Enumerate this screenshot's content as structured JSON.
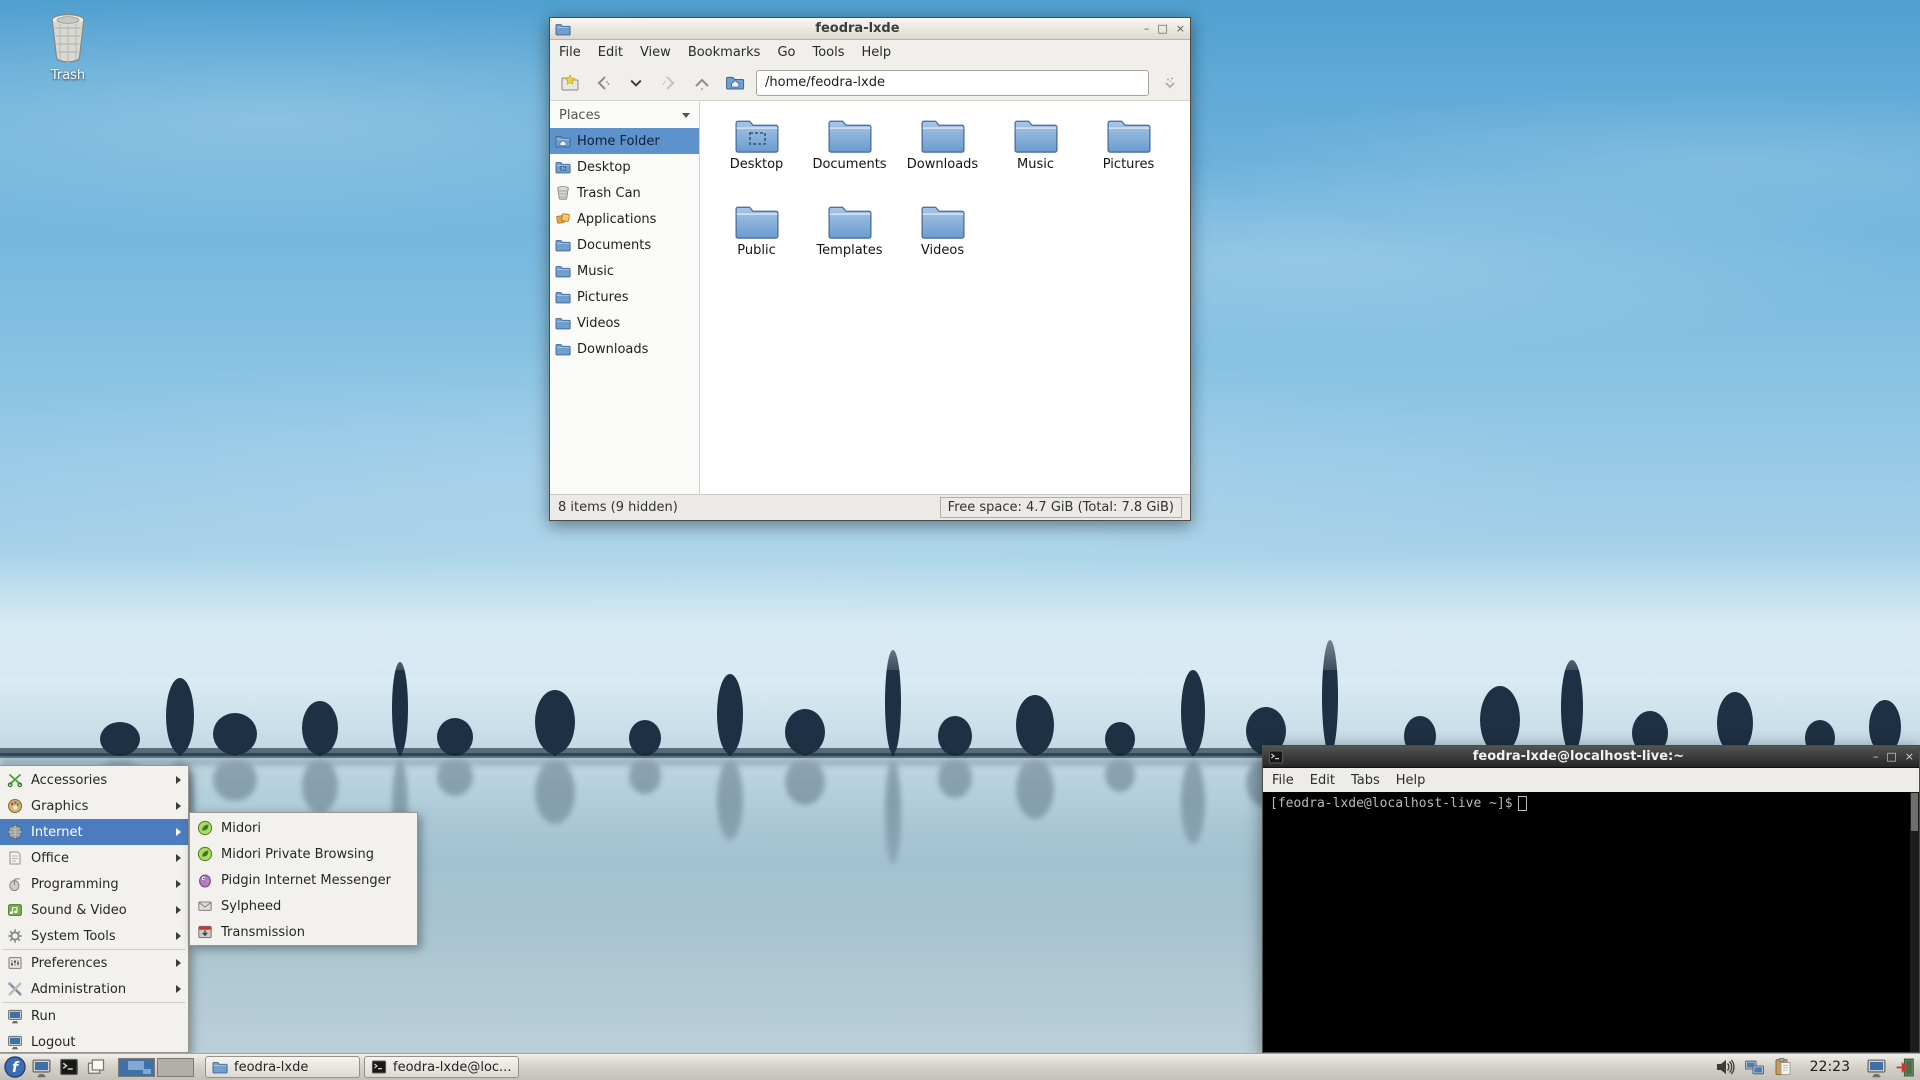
{
  "desktop": {
    "trash_label": "Trash",
    "trash_icon": "trash-basket-icon",
    "wallpaper": "blue foggy treeline with water reflection"
  },
  "file_manager": {
    "title": "feodra-lxde",
    "window_icon": "folder-icon",
    "buttons": {
      "minimize": "–",
      "maximize": "□",
      "close": "×"
    },
    "menu": {
      "file": "File",
      "edit": "Edit",
      "view": "View",
      "bookmarks": "Bookmarks",
      "go": "Go",
      "tools": "Tools",
      "help": "Help"
    },
    "toolbar_icons": [
      "new-tab-folder-icon",
      "back-icon",
      "history-dropdown-icon",
      "forward-icon",
      "up-icon",
      "home-icon",
      "jump-to-icon"
    ],
    "address": "/home/feodra-lxde",
    "places": {
      "header": "Places",
      "items": [
        {
          "label": "Home Folder",
          "icon": "home-folder-icon",
          "selected": true
        },
        {
          "label": "Desktop",
          "icon": "desktop-folder-icon",
          "selected": false
        },
        {
          "label": "Trash Can",
          "icon": "trash-icon",
          "selected": false
        },
        {
          "label": "Applications",
          "icon": "applications-icon",
          "selected": false
        },
        {
          "label": "Documents",
          "icon": "folder-icon",
          "selected": false
        },
        {
          "label": "Music",
          "icon": "folder-icon",
          "selected": false
        },
        {
          "label": "Pictures",
          "icon": "folder-icon",
          "selected": false
        },
        {
          "label": "Videos",
          "icon": "folder-icon",
          "selected": false
        },
        {
          "label": "Downloads",
          "icon": "folder-icon",
          "selected": false
        }
      ]
    },
    "folders": [
      {
        "name": "Desktop",
        "icon": "folder-desktop-icon"
      },
      {
        "name": "Documents",
        "icon": "folder-icon"
      },
      {
        "name": "Downloads",
        "icon": "folder-icon"
      },
      {
        "name": "Music",
        "icon": "folder-icon"
      },
      {
        "name": "Pictures",
        "icon": "folder-icon"
      },
      {
        "name": "Public",
        "icon": "folder-icon"
      },
      {
        "name": "Templates",
        "icon": "folder-icon"
      },
      {
        "name": "Videos",
        "icon": "folder-icon"
      }
    ],
    "status_left": "8 items (9 hidden)",
    "status_right": "Free space: 4.7 GiB (Total: 7.8 GiB)"
  },
  "terminal": {
    "title": "feodra-lxde@localhost-live:~",
    "window_icon": "terminal-icon",
    "buttons": {
      "minimize": "–",
      "maximize": "□",
      "close": "×"
    },
    "menu": {
      "file": "File",
      "edit": "Edit",
      "tabs": "Tabs",
      "help": "Help"
    },
    "prompt": "[feodra-lxde@localhost-live ~]$"
  },
  "app_menu": {
    "items": [
      {
        "label": "Accessories",
        "icon": "accessories-icon",
        "has_submenu": true
      },
      {
        "label": "Graphics",
        "icon": "graphics-icon",
        "has_submenu": true
      },
      {
        "label": "Internet",
        "icon": "internet-globe-icon",
        "has_submenu": true,
        "selected": true
      },
      {
        "label": "Office",
        "icon": "office-icon",
        "has_submenu": true
      },
      {
        "label": "Programming",
        "icon": "programming-icon",
        "has_submenu": true
      },
      {
        "label": "Sound & Video",
        "icon": "sound-video-icon",
        "has_submenu": true
      },
      {
        "label": "System Tools",
        "icon": "system-tools-icon",
        "has_submenu": true
      },
      {
        "label": "Preferences",
        "icon": "preferences-icon",
        "has_submenu": true
      },
      {
        "label": "Administration",
        "icon": "administration-icon",
        "has_submenu": true
      },
      {
        "label": "Run",
        "icon": "run-monitor-icon",
        "has_submenu": false
      },
      {
        "label": "Logout",
        "icon": "logout-monitor-icon",
        "has_submenu": false
      }
    ]
  },
  "internet_submenu": {
    "items": [
      {
        "label": "Midori",
        "icon": "midori-leaf-icon"
      },
      {
        "label": "Midori Private Browsing",
        "icon": "midori-leaf-icon"
      },
      {
        "label": "Pidgin Internet Messenger",
        "icon": "pidgin-icon"
      },
      {
        "label": "Sylpheed",
        "icon": "sylpheed-icon"
      },
      {
        "label": "Transmission",
        "icon": "transmission-icon"
      }
    ]
  },
  "taskbar": {
    "launchers": [
      "fedora-menu-icon",
      "file-manager-launcher-icon",
      "terminal-launcher-icon",
      "iconify-windows-icon"
    ],
    "pager_workspaces": 2,
    "tasks": [
      {
        "label": "feodra-lxde",
        "icon": "folder-icon"
      },
      {
        "label": "feodra-lxde@loc...",
        "icon": "terminal-icon"
      }
    ],
    "tray_icons": [
      "volume-icon",
      "network-icon",
      "clipboard-icon",
      "screenlock-icon",
      "logout-door-icon"
    ],
    "clock": "22:23"
  },
  "colors": {
    "selection_blue": "#4b7cc0",
    "sidebar_selection": "#5d92cd",
    "folder_blue": "#6f9ecf",
    "terminal_titlebar": "#333333",
    "taskbar_bg": "#d4d1ca",
    "wallpaper_sky": "#74b6de",
    "treeline": "#1e3144"
  }
}
